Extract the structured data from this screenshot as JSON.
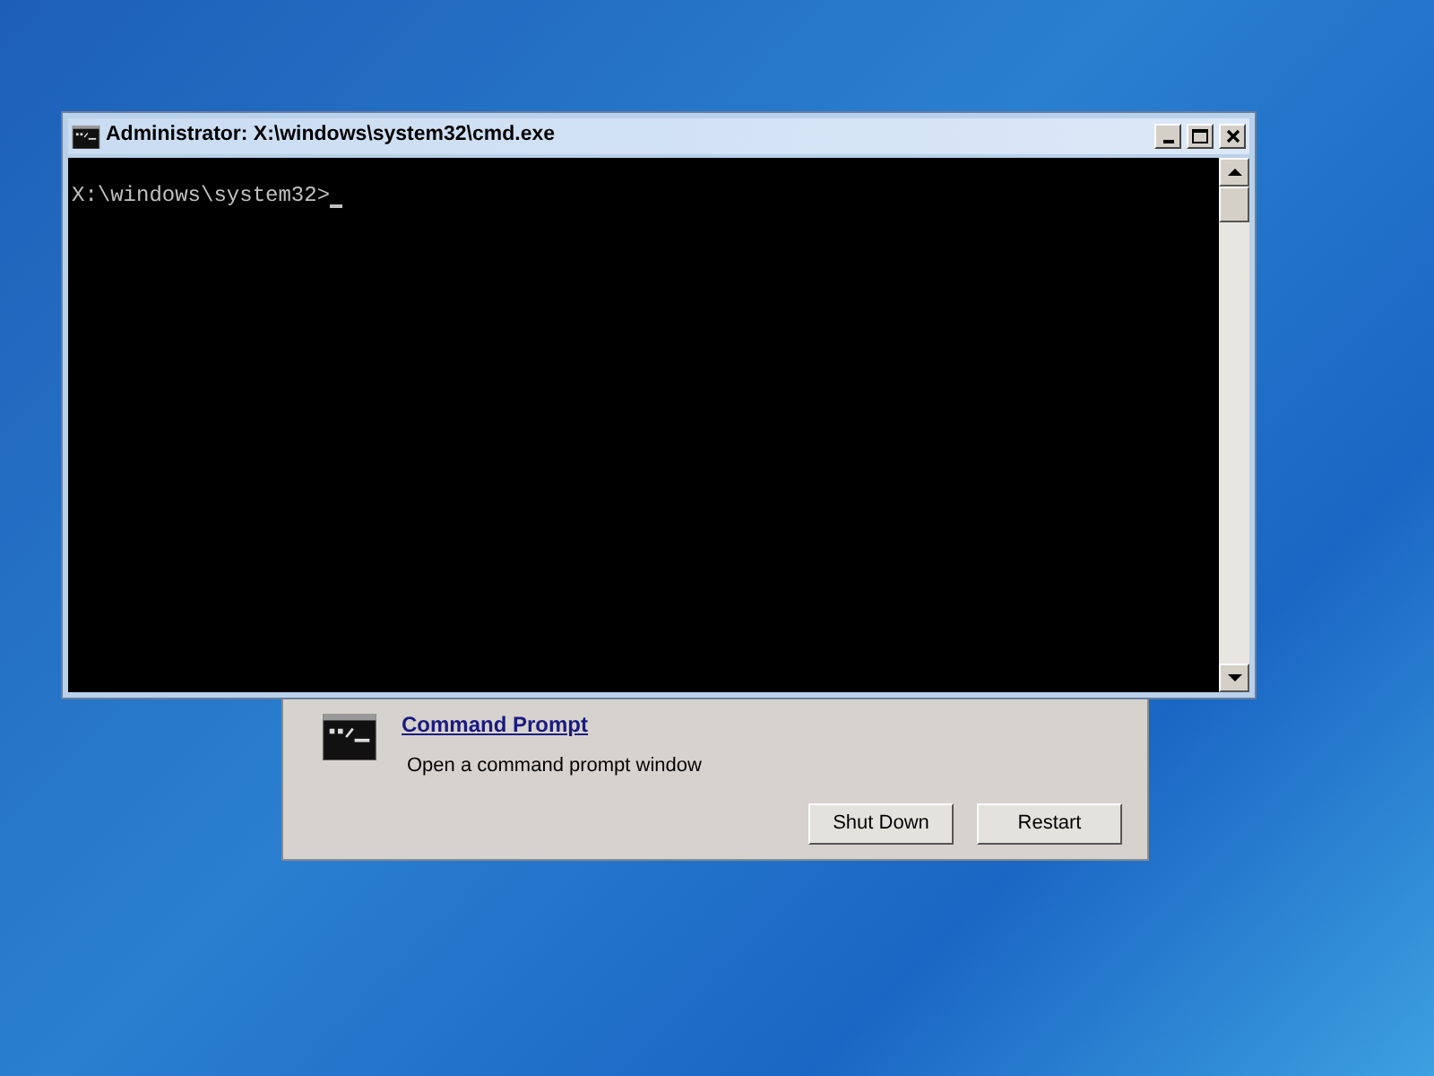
{
  "cmd_window": {
    "title": "Administrator: X:\\windows\\system32\\cmd.exe",
    "prompt": "X:\\windows\\system32>"
  },
  "recovery_dialog": {
    "option": {
      "title": "Command Prompt",
      "description": "Open a command prompt window"
    },
    "buttons": [
      "Shut Down",
      "Restart"
    ]
  }
}
